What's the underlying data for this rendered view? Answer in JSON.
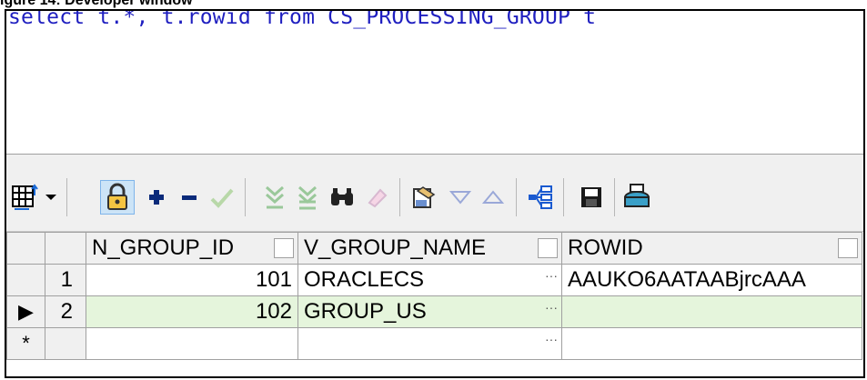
{
  "caption": "igure 14: Developer window",
  "editor": {
    "sql": "select t.*, t.rowid from CS_PROCESSING_GROUP t"
  },
  "toolbar": {
    "icons": [
      "grid-options-icon",
      "dropdown-arrow-icon",
      "lock-icon",
      "insert-record-icon",
      "delete-record-icon",
      "post-changes-icon",
      "next-page-icon",
      "last-page-icon",
      "find-icon",
      "clear-icon",
      "query-by-example-icon",
      "sort-desc-icon",
      "sort-asc-icon",
      "export-icon",
      "save-icon",
      "print-icon"
    ]
  },
  "grid": {
    "columns": [
      "N_GROUP_ID",
      "V_GROUP_NAME",
      "ROWID"
    ],
    "rows": [
      {
        "num": "1",
        "id": "101",
        "name": "ORACLECS",
        "rowid": "AAUKO6AATAABjrcAAA"
      },
      {
        "num": "2",
        "id": "102",
        "name": "GROUP_US",
        "rowid": ""
      }
    ],
    "new_row_marker": "*",
    "current_marker": "▶",
    "ellipsis": "···"
  },
  "colors": {
    "sql_text": "#1f1fc0",
    "current_row": "#e5f5dc",
    "toolbar_bg": "#f0f0f0"
  }
}
